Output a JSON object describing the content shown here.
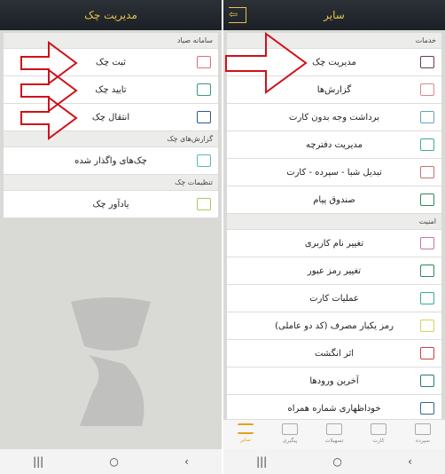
{
  "left": {
    "title": "مدیریت چک",
    "sections": [
      {
        "label": "سامانه صیاد",
        "items": [
          {
            "label": "ثبت چک",
            "icon": "check-register-icon",
            "color": "#d9707f"
          },
          {
            "label": "تایید چک",
            "icon": "check-confirm-icon",
            "color": "#3a9a7a"
          },
          {
            "label": "انتقال چک",
            "icon": "check-transfer-icon",
            "color": "#2c5a8a"
          }
        ]
      },
      {
        "label": "گزارش‌های چک",
        "items": [
          {
            "label": "چک‌های واگذار شده",
            "icon": "assigned-checks-icon",
            "color": "#5ab8b8"
          }
        ]
      },
      {
        "label": "تنظیمات چک",
        "items": [
          {
            "label": "یادآور چک",
            "icon": "check-reminder-icon",
            "color": "#a8c86a"
          }
        ]
      }
    ]
  },
  "right": {
    "title": "سایر",
    "sections": [
      {
        "label": "خدمات",
        "items": [
          {
            "label": "مدیریت چک",
            "icon": "check-management-icon",
            "color": "#6a3a5a"
          },
          {
            "label": "گزارش‌ها",
            "icon": "reports-icon",
            "color": "#d98a8a"
          },
          {
            "label": "برداشت وجه بدون کارت",
            "icon": "cardless-withdrawal-icon",
            "color": "#6aa0c0"
          },
          {
            "label": "مدیریت دفترچه",
            "icon": "booklet-icon",
            "color": "#3aaa9a"
          },
          {
            "label": "تبدیل شبا - سپرده - کارت",
            "icon": "sheba-convert-icon",
            "color": "#c87070"
          },
          {
            "label": "صندوق پیام",
            "icon": "message-box-icon",
            "color": "#2a8a5a"
          }
        ]
      },
      {
        "label": "امنیت",
        "items": [
          {
            "label": "تغییر نام کاربری",
            "icon": "user-icon",
            "color": "#d070a0"
          },
          {
            "label": "تغییر رمز عبور",
            "icon": "lock-icon",
            "color": "#2a8a5a"
          },
          {
            "label": "عملیات کارت",
            "icon": "card-icon",
            "color": "#3aaa9a"
          },
          {
            "label": "رمز یکبار مصرف (کد دو عاملی)",
            "icon": "otp-lock-icon",
            "color": "#d8d060"
          },
          {
            "label": "اثر انگشت",
            "icon": "fingerprint-icon",
            "color": "#d04040"
          },
          {
            "label": "آخرین ورودها",
            "icon": "last-logins-icon",
            "color": "#2a7a7a"
          },
          {
            "label": "خوداظهاری شماره همراه",
            "icon": "mobile-icon",
            "color": "#2a6a9a"
          }
        ]
      }
    ],
    "tabs": [
      {
        "label": "سپرده",
        "icon": "deposit-icon"
      },
      {
        "label": "کارت",
        "icon": "card-icon"
      },
      {
        "label": "تسهیلات",
        "icon": "loans-icon"
      },
      {
        "label": "پیگیری",
        "icon": "tracking-icon"
      },
      {
        "label": "سایر",
        "icon": "menu-icon",
        "active": true
      }
    ]
  },
  "system_nav": {
    "recents": "|||",
    "home": "○",
    "back": "‹"
  },
  "accent": "#e3a21a",
  "arrow_color": "#d0101a"
}
